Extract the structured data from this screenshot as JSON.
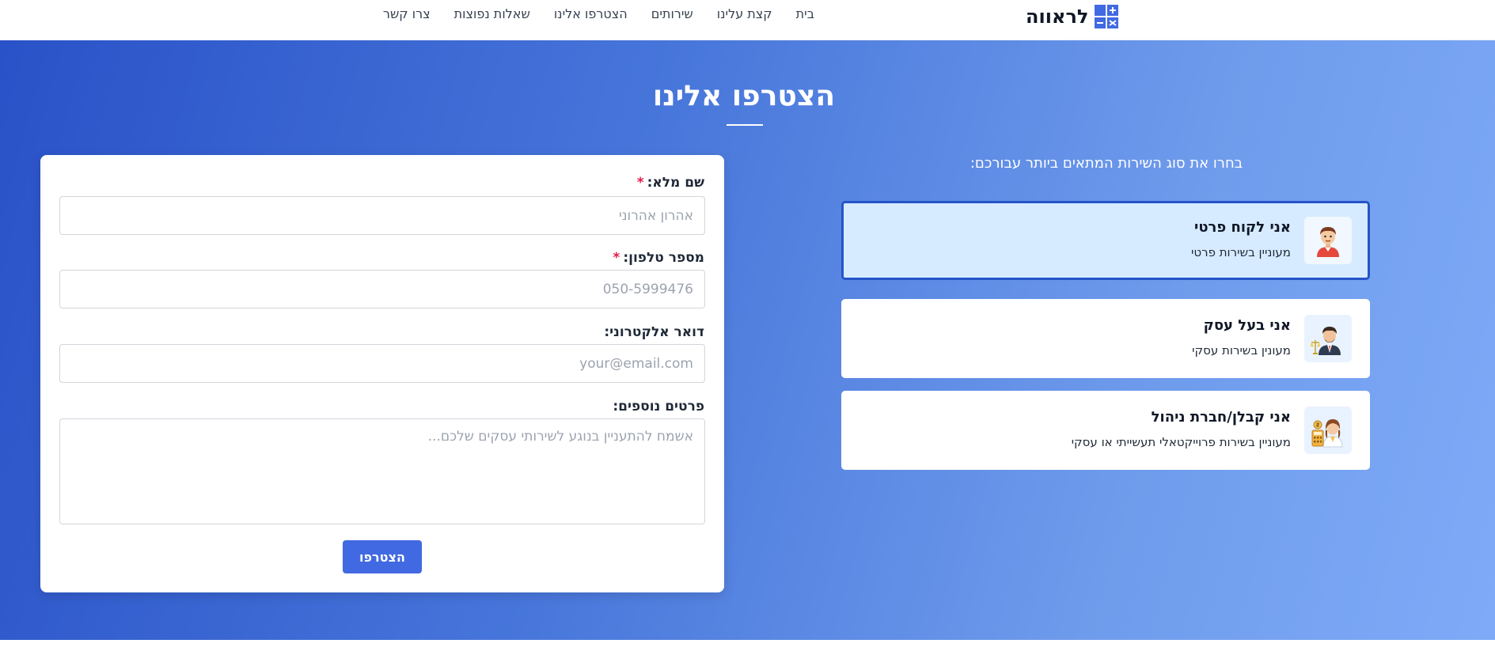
{
  "header": {
    "logo_text": "לראווה",
    "nav": [
      "בית",
      "קצת עלינו",
      "שירותים",
      "הצטרפו אלינו",
      "שאלות נפוצות",
      "צרו קשר"
    ]
  },
  "hero": {
    "title": "הצטרפו אלינו"
  },
  "form": {
    "full_name": {
      "label": "שם מלא:",
      "required_mark": "*",
      "placeholder": "אהרון אהרוני",
      "value": ""
    },
    "phone": {
      "label": "מספר טלפון:",
      "required_mark": "*",
      "placeholder": "050-5999476",
      "value": ""
    },
    "email": {
      "label": "דואר אלקטרוני:",
      "placeholder": "your@email.com",
      "value": ""
    },
    "details": {
      "label": "פרטים נוספים:",
      "placeholder": "אשמח להתעניין בנוגע לשירותי עסקים שלכם...",
      "value": ""
    },
    "submit_label": "הצטרפו"
  },
  "service_types": {
    "prompt": "בחרו את סוג השירות המתאים ביותר עבורכם:",
    "selected_index": 0,
    "items": [
      {
        "title": "אני לקוח פרטי",
        "description": "מעוניין בשירות פרטי",
        "icon": "private-customer-icon"
      },
      {
        "title": "אני בעל עסק",
        "description": "מעונין בשירות עסקי",
        "icon": "business-owner-icon"
      },
      {
        "title": "אני קבלן/חברת ניהול",
        "description": "מעוניין בשירות פרוייקטאלי תעשייתי או עסקי",
        "icon": "contractor-icon"
      }
    ]
  },
  "colors": {
    "primary": "#4169e1",
    "selected_border": "#2554c7",
    "selected_bg": "#d6ebff",
    "required": "#e11d48"
  }
}
